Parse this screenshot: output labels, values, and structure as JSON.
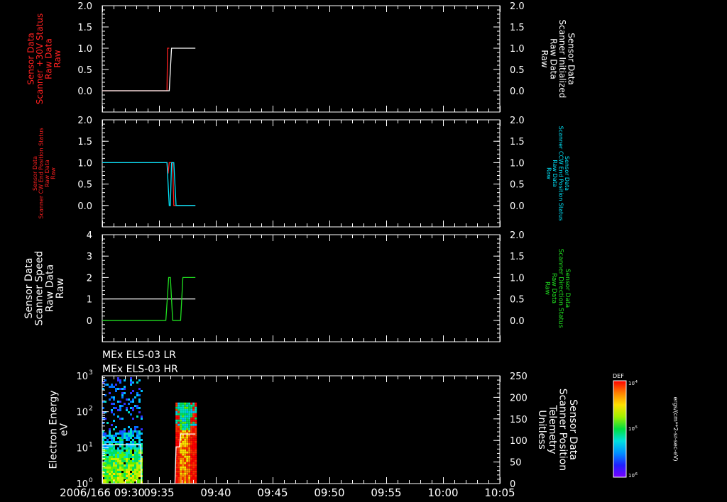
{
  "chart_data": [
    {
      "type": "line",
      "left_axis": {
        "label_lines": [
          "Sensor Data",
          "Scanner +30V Status",
          "Raw Data",
          "Raw"
        ],
        "color": "#ff2020",
        "ylim": [
          -0.5,
          2.0
        ],
        "ticks": [
          "2.0",
          "1.5",
          "1.0",
          "0.5",
          "0.0"
        ]
      },
      "right_axis": {
        "label_lines": [
          "Sensor Data",
          "Scanner Initialized",
          "Raw Data",
          "Raw"
        ],
        "color": "#ffffff",
        "ylim": [
          -0.5,
          2.0
        ],
        "ticks": [
          "2.0",
          "1.5",
          "1.0",
          "0.5",
          "0.0"
        ]
      },
      "series": [
        {
          "axis": "left",
          "color": "#ff2020",
          "points": [
            [
              30.0,
              0
            ],
            [
              35.7,
              0
            ],
            [
              35.75,
              1
            ],
            [
              35.9,
              1
            ]
          ]
        },
        {
          "axis": "right",
          "color": "#ffffff",
          "points": [
            [
              30.0,
              0
            ],
            [
              35.9,
              0
            ],
            [
              36.1,
              1
            ],
            [
              38.2,
              1
            ]
          ]
        }
      ]
    },
    {
      "type": "line",
      "left_axis": {
        "label_lines": [
          "Sensor Data",
          "Scanner CW End Position Status",
          "Raw Data",
          "Raw"
        ],
        "color": "#ff2020",
        "ylim": [
          -0.5,
          2.0
        ],
        "ticks": [
          "2.0",
          "1.5",
          "1.0",
          "0.5",
          "0.0"
        ]
      },
      "right_axis": {
        "label_lines": [
          "Sensor Data",
          "Scanner CCW End Position Status",
          "Raw Data",
          "Raw"
        ],
        "color": "#00e8ff",
        "ylim": [
          -0.5,
          2.0
        ],
        "ticks": [
          "2.0",
          "1.5",
          "1.0",
          "0.5",
          "0.0"
        ]
      },
      "series": [
        {
          "axis": "left",
          "color": "#ff2020",
          "points": [
            [
              30.0,
              1
            ],
            [
              35.7,
              1
            ],
            [
              35.8,
              0.75
            ],
            [
              35.9,
              1
            ],
            [
              36.2,
              1
            ],
            [
              36.3,
              0
            ],
            [
              38.2,
              0
            ]
          ]
        },
        {
          "axis": "right",
          "color": "#00e8ff",
          "points": [
            [
              30.0,
              1
            ],
            [
              35.7,
              1
            ],
            [
              35.9,
              0
            ],
            [
              36.0,
              0
            ],
            [
              36.1,
              1
            ],
            [
              36.3,
              1
            ],
            [
              36.5,
              0
            ],
            [
              38.2,
              0
            ]
          ]
        }
      ]
    },
    {
      "type": "line",
      "left_axis": {
        "label_lines": [
          "Sensor Data",
          "Scanner Speed",
          "Raw Data",
          "Raw"
        ],
        "color": "#ffffff",
        "ylim": [
          -1,
          4
        ],
        "ticks": [
          "4",
          "3",
          "2",
          "1",
          "0"
        ]
      },
      "right_axis": {
        "label_lines": [
          "Sensor Data",
          "Scanner Direction Status",
          "Raw Data",
          "Raw"
        ],
        "color": "#20e020",
        "ylim": [
          -0.5,
          2.0
        ],
        "ticks": [
          "2.0",
          "1.5",
          "1.0",
          "0.5",
          "0.0"
        ]
      },
      "series": [
        {
          "axis": "left",
          "color": "#ffffff",
          "points": [
            [
              30.0,
              1
            ],
            [
              38.2,
              1
            ]
          ]
        },
        {
          "axis": "right",
          "color": "#20e020",
          "points": [
            [
              30.0,
              0
            ],
            [
              35.6,
              0
            ],
            [
              35.85,
              1
            ],
            [
              36.0,
              1
            ],
            [
              36.2,
              0
            ],
            [
              36.9,
              0
            ],
            [
              37.1,
              1
            ],
            [
              38.2,
              1
            ]
          ]
        }
      ]
    },
    {
      "type": "heatmap",
      "title_lines": [
        "MEx ELS-03 LR",
        "MEx ELS-03 HR"
      ],
      "ylabel_lines": [
        "Electron Energy",
        "eV"
      ],
      "y_log_ticks": [
        {
          "base": "10",
          "exp": "3"
        },
        {
          "base": "10",
          "exp": "2"
        },
        {
          "base": "10",
          "exp": "1"
        },
        {
          "base": "10",
          "exp": "0"
        }
      ],
      "ylim": [
        1,
        1000
      ],
      "right_axis": {
        "label_lines": [
          "Sensor Data",
          "Scanner Position",
          "Telemetry",
          "Unitless"
        ],
        "color": "#ffffff",
        "ylim": [
          0,
          250
        ],
        "ticks": [
          "250",
          "200",
          "150",
          "100",
          "50",
          "0"
        ]
      },
      "overlay_points": [
        [
          30.0,
          90
        ],
        [
          33.4,
          90
        ],
        [
          33.45,
          0
        ],
        [
          36.4,
          0
        ],
        [
          36.5,
          85
        ],
        [
          36.8,
          85
        ],
        [
          36.9,
          115
        ],
        [
          38.2,
          115
        ]
      ],
      "colorbar": {
        "title": "DEF",
        "ticks": [
          {
            "exp": "-4"
          },
          {
            "exp": "-5"
          },
          {
            "exp": "-6"
          }
        ],
        "unit": "ergs/(cm**2-sr-sec-eV)"
      }
    }
  ],
  "x_axis": {
    "start_label": "2006/166 09:30",
    "ticks": [
      "09:30",
      "09:35",
      "09:40",
      "09:45",
      "09:50",
      "09:55",
      "10:00",
      "10:05"
    ],
    "tick_values": [
      30,
      35,
      40,
      45,
      50,
      55,
      60,
      65
    ],
    "xlim": [
      30,
      65
    ]
  }
}
